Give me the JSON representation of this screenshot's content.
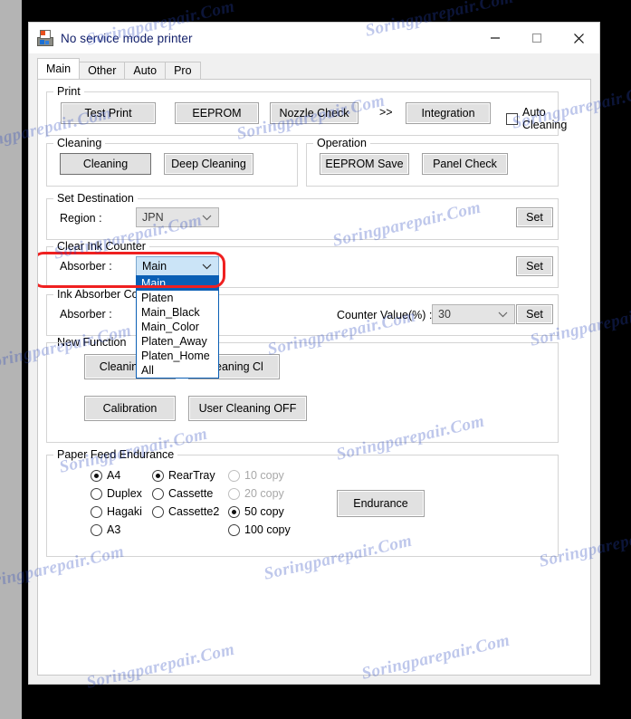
{
  "window": {
    "title": "No service mode printer",
    "icon": "printer-icon",
    "controls": {
      "minimize": "minimize-icon",
      "maximize": "maximize-icon",
      "close": "close-icon"
    }
  },
  "tabs": [
    {
      "label": "Main",
      "active": true
    },
    {
      "label": "Other",
      "active": false
    },
    {
      "label": "Auto",
      "active": false
    },
    {
      "label": "Pro",
      "active": false
    }
  ],
  "print_group": {
    "legend": "Print",
    "buttons": [
      "Test Print",
      "EEPROM",
      "Nozzle Check"
    ],
    "chevron": ">>",
    "integration_button": "Integration",
    "auto_cleaning": {
      "label": "Auto Cleaning",
      "checked": false
    }
  },
  "cleaning_group": {
    "legend": "Cleaning",
    "buttons": [
      "Cleaning",
      "Deep Cleaning"
    ]
  },
  "operation_group": {
    "legend": "Operation",
    "buttons": [
      "EEPROM Save",
      "Panel Check"
    ]
  },
  "set_destination": {
    "legend": "Set Destination",
    "region_label": "Region :",
    "region_value": "JPN",
    "set_button": "Set"
  },
  "clear_ink_counter": {
    "legend": "Clear Ink Counter",
    "absorber_label": "Absorber :",
    "absorber_value": "Main",
    "set_button": "Set",
    "dropdown_open": true,
    "options": [
      "Main",
      "Platen",
      "Main_Black",
      "Main_Color",
      "Platen_Away",
      "Platen_Home",
      "All"
    ],
    "selected_option": "Main"
  },
  "ink_absorber_counter": {
    "legend": "Ink Absorber Counter",
    "absorber_label": "Absorber :",
    "counter_label": "Counter Value(%) :",
    "counter_value": "30",
    "set_button": "Set"
  },
  "new_function": {
    "legend": "New Function",
    "buttons": [
      "Cleaning Bk",
      "Cleaning Cl",
      "Calibration",
      "User Cleaning OFF"
    ]
  },
  "paper_feed_endurance": {
    "legend": "Paper Feed Endurance",
    "paper_sizes": [
      {
        "label": "A4",
        "selected": true,
        "disabled": false
      },
      {
        "label": "Duplex",
        "selected": false,
        "disabled": false
      },
      {
        "label": "Hagaki",
        "selected": false,
        "disabled": false
      },
      {
        "label": "A3",
        "selected": false,
        "disabled": false
      }
    ],
    "sources": [
      {
        "label": "RearTray",
        "selected": true,
        "disabled": false
      },
      {
        "label": "Cassette",
        "selected": false,
        "disabled": false
      },
      {
        "label": "Cassette2",
        "selected": false,
        "disabled": false
      }
    ],
    "copies": [
      {
        "label": "10 copy",
        "selected": false,
        "disabled": true
      },
      {
        "label": "20 copy",
        "selected": false,
        "disabled": true
      },
      {
        "label": "50 copy",
        "selected": true,
        "disabled": false
      },
      {
        "label": "100 copy",
        "selected": false,
        "disabled": false
      }
    ],
    "endurance_button": "Endurance"
  },
  "annotation": {
    "highlight_color": "#ef2020",
    "target": "absorber-combobox"
  },
  "watermark": {
    "text": "Soringparepair.Com",
    "color": "#2846be"
  }
}
